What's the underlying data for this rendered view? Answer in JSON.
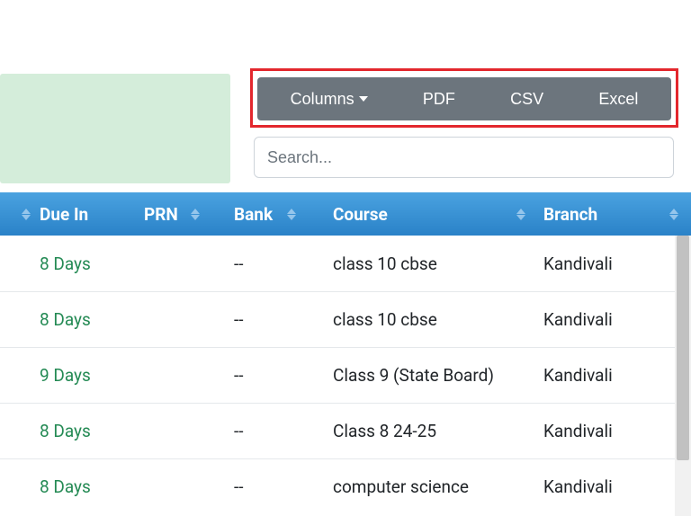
{
  "toolbar": {
    "columns_label": "Columns",
    "pdf_label": "PDF",
    "csv_label": "CSV",
    "excel_label": "Excel"
  },
  "search": {
    "placeholder": "Search...",
    "value": ""
  },
  "table": {
    "headers": {
      "due_in": "Due In",
      "prn": "PRN",
      "bank": "Bank",
      "course": "Course",
      "branch": "Branch"
    },
    "rows": [
      {
        "due_in": "8 Days",
        "prn": "",
        "bank": "--",
        "course": "class 10 cbse",
        "branch": "Kandivali"
      },
      {
        "due_in": "8 Days",
        "prn": "",
        "bank": "--",
        "course": "class 10 cbse",
        "branch": "Kandivali"
      },
      {
        "due_in": "9 Days",
        "prn": "",
        "bank": "--",
        "course": "Class 9 (State Board)",
        "branch": "Kandivali"
      },
      {
        "due_in": "8 Days",
        "prn": "",
        "bank": "--",
        "course": "Class 8 24-25",
        "branch": "Kandivali"
      },
      {
        "due_in": "8 Days",
        "prn": "",
        "bank": "--",
        "course": "computer science",
        "branch": "Kandivali"
      }
    ]
  }
}
